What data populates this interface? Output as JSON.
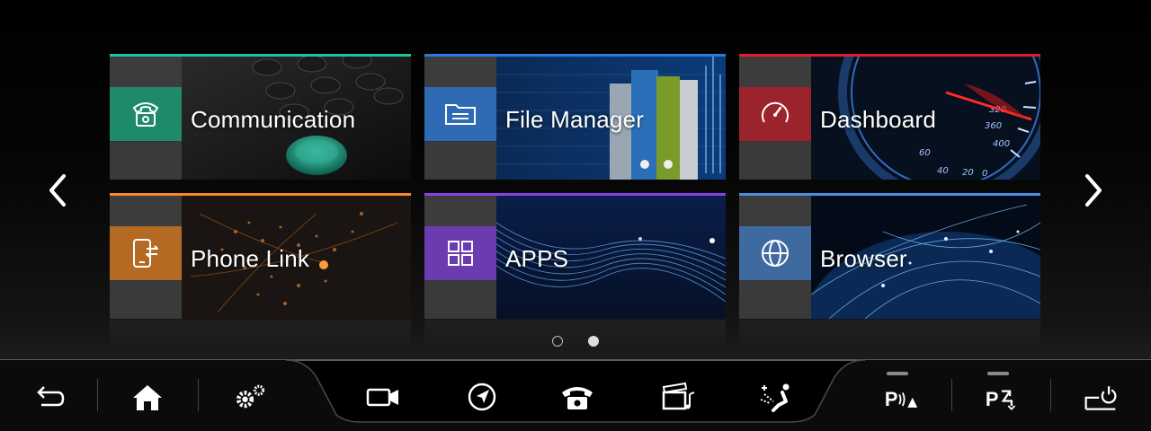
{
  "tiles": [
    {
      "label": "Communication",
      "accent": "#1fc39a",
      "iconbox": "#1f8a6a",
      "icon": "telephone-icon"
    },
    {
      "label": "File Manager",
      "accent": "#2a7be0",
      "iconbox": "#2f6bb5",
      "icon": "folder-icon"
    },
    {
      "label": "Dashboard",
      "accent": "#e21e2e",
      "iconbox": "#9b232c",
      "icon": "speedometer-icon"
    },
    {
      "label": "Phone Link",
      "accent": "#f28a2a",
      "iconbox": "#b46a22",
      "icon": "phone-link-icon"
    },
    {
      "label": "APPS",
      "accent": "#8c3ee6",
      "iconbox": "#6b3bb0",
      "icon": "apps-grid-icon"
    },
    {
      "label": "Browser",
      "accent": "#4a8ce0",
      "iconbox": "#3e6aa0",
      "icon": "globe-icon"
    }
  ],
  "pager": {
    "current": 2,
    "total": 2
  },
  "dock": {
    "icons": [
      "back-icon",
      "home-icon",
      "settings-icon",
      "camera-icon",
      "navigation-icon",
      "telephone-icon",
      "media-icon",
      "climate-icon",
      "parking-sensor-icon",
      "parking-assist-icon",
      "power-icon"
    ]
  }
}
